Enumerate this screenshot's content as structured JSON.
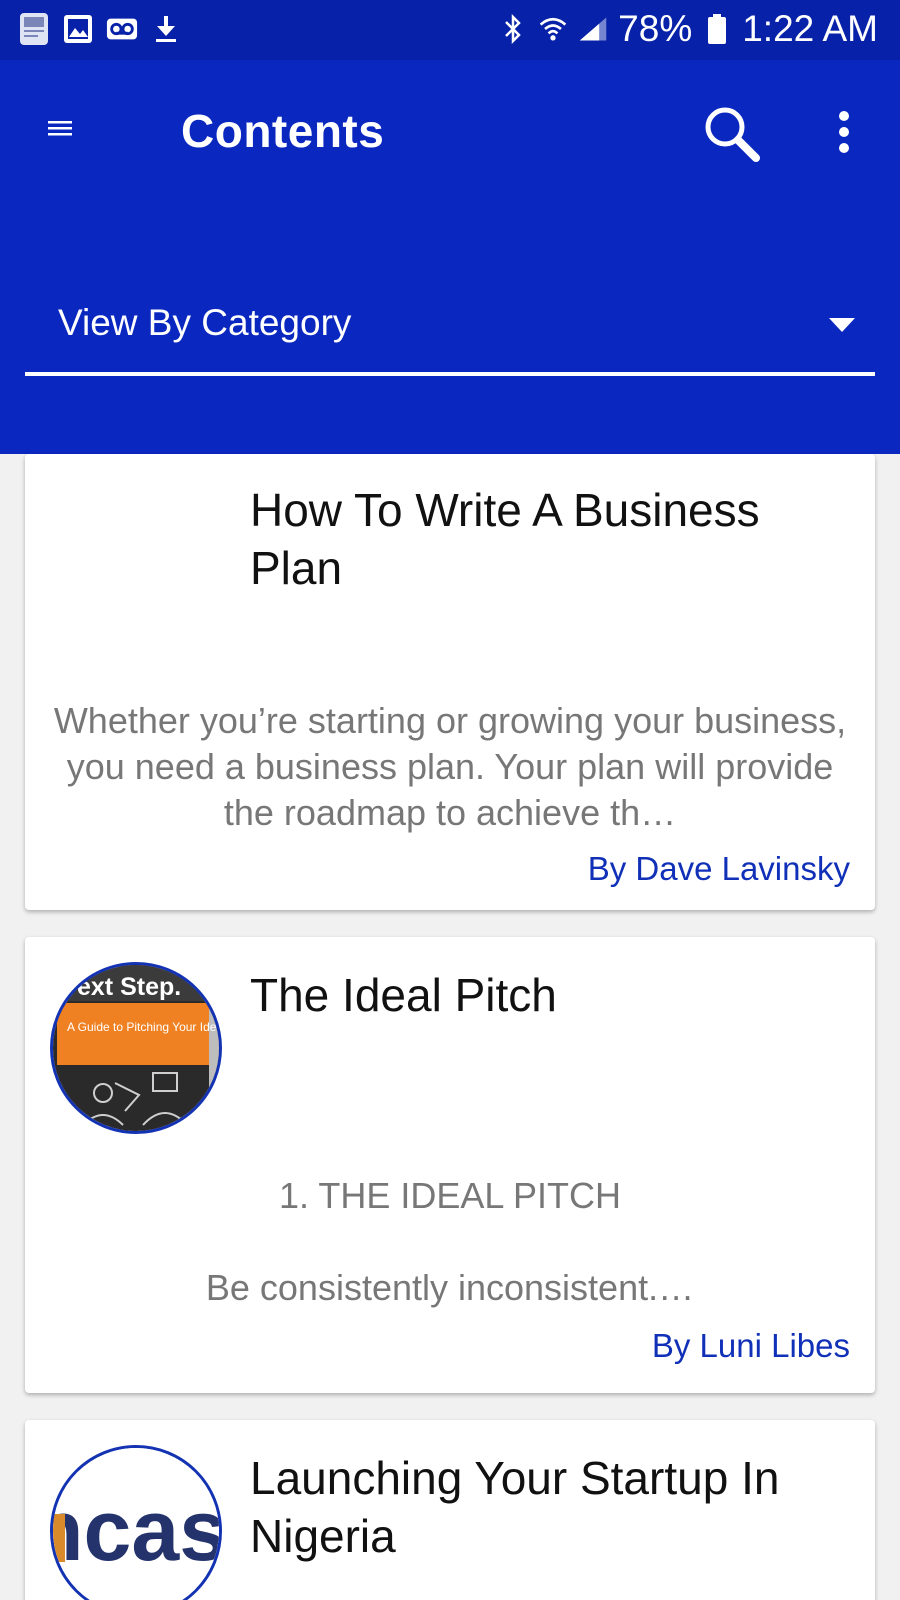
{
  "status_bar": {
    "battery": "78%",
    "time": "1:22 AM",
    "left_icons": [
      "bible-icon",
      "image-icon",
      "voicemail-icon",
      "download-icon"
    ],
    "right_icons": [
      "bluetooth-icon",
      "wifi-icon",
      "signal-icon",
      "battery-icon"
    ]
  },
  "app_bar": {
    "title": "Contents",
    "background": "#0a28c0"
  },
  "category_select": {
    "label": "View By Category"
  },
  "articles": [
    {
      "title": "How To Write A Business Plan",
      "description": "Whether you’re starting or growing your business, you need a business plan. Your plan will provide the roadmap to achieve th…",
      "author": "By Dave Lavinsky"
    },
    {
      "title": "The Ideal Pitch",
      "subheading": "1. THE IDEAL PITCH",
      "description": "Be consistently inconsistent.…",
      "author": "By Luni Libes",
      "thumbnail": {
        "header": "ext Step.",
        "cover_text": "A Guide to Pitching Your Idea"
      }
    },
    {
      "title": "Launching Your Startup In Nigeria",
      "thumbnail": {
        "logo_text": "ncas"
      }
    }
  ],
  "colors": {
    "primary": "#0a28c0",
    "status_bar": "#0722a8",
    "author_link": "#1030b8",
    "description": "#777777"
  }
}
